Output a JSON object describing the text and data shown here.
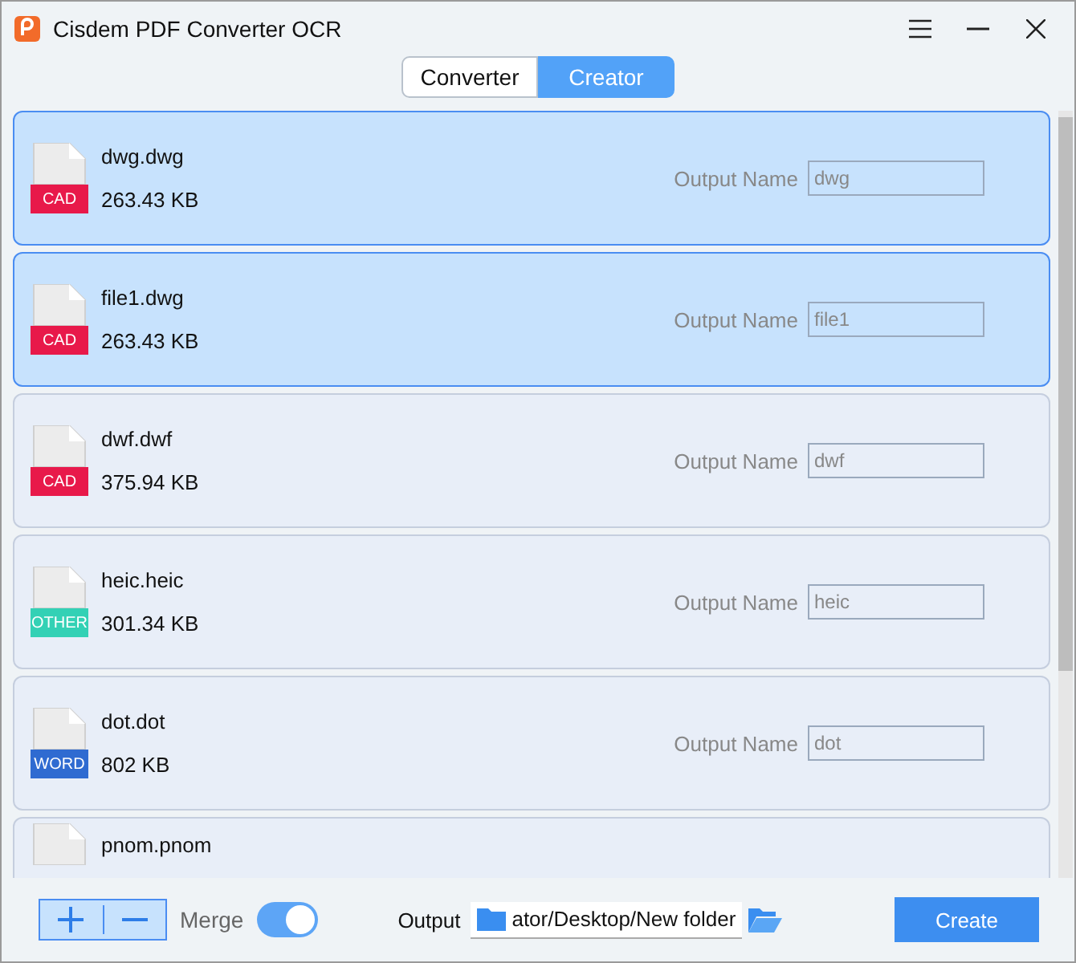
{
  "window": {
    "title": "Cisdem PDF Converter OCR"
  },
  "tabs": [
    {
      "label": "Converter",
      "selected": false
    },
    {
      "label": "Creator",
      "selected": true
    }
  ],
  "files": [
    {
      "name": "dwg.dwg",
      "size": "263.43 KB",
      "type": "CAD",
      "color": "#e8194a",
      "selected": true,
      "output_label": "Output Name",
      "output_name": "dwg"
    },
    {
      "name": "file1.dwg",
      "size": "263.43 KB",
      "type": "CAD",
      "color": "#e8194a",
      "selected": true,
      "output_label": "Output Name",
      "output_name": "file1"
    },
    {
      "name": "dwf.dwf",
      "size": "375.94 KB",
      "type": "CAD",
      "color": "#e8194a",
      "selected": false,
      "output_label": "Output Name",
      "output_name": "dwf"
    },
    {
      "name": "heic.heic",
      "size": "301.34 KB",
      "type": "OTHER",
      "color": "#33d1b5",
      "selected": false,
      "output_label": "Output Name",
      "output_name": "heic"
    },
    {
      "name": "dot.dot",
      "size": "802 KB",
      "type": "WORD",
      "color": "#2f6bd1",
      "selected": false,
      "output_label": "Output Name",
      "output_name": "dot"
    },
    {
      "name": "pnom.pnom",
      "selected": false
    }
  ],
  "footer": {
    "merge_label": "Merge",
    "merge_on": true,
    "output_label": "Output",
    "output_path": "ator/Desktop/New folder",
    "create_button": "Create"
  }
}
